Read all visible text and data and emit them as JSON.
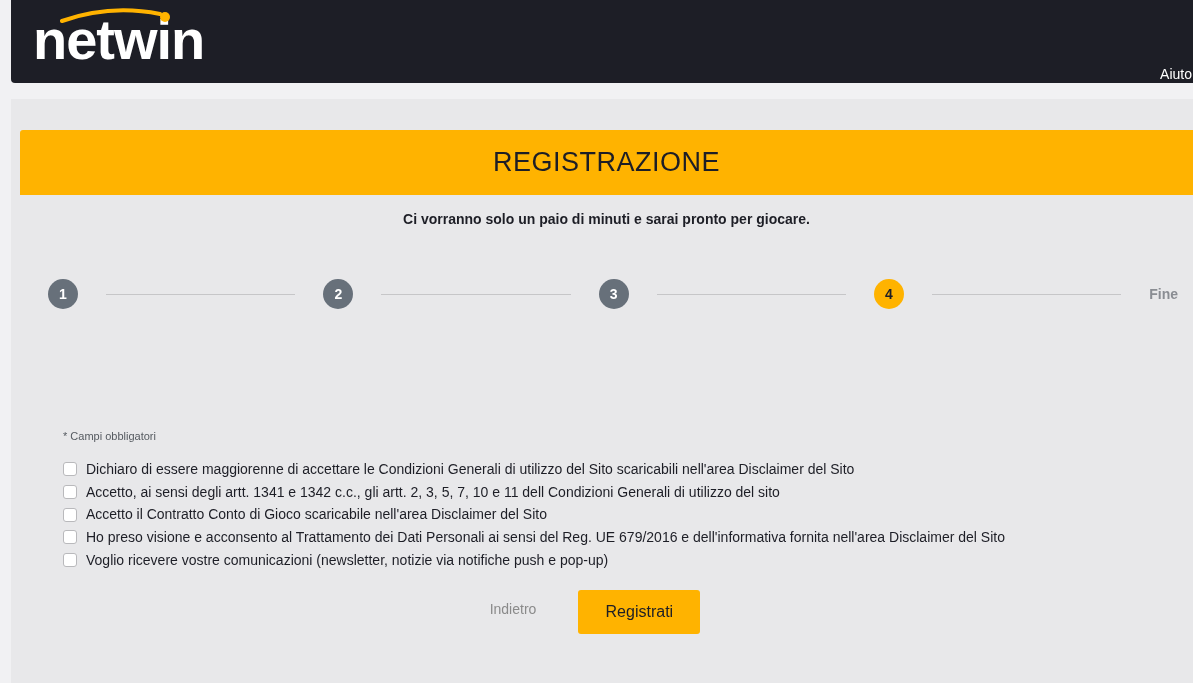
{
  "header": {
    "logo": "netwin",
    "help_link": "Aiuto"
  },
  "registration": {
    "title": "REGISTRAZIONE",
    "subtitle": "Ci vorranno solo un paio di minuti e sarai pronto per giocare.",
    "steps": [
      {
        "kind": "number",
        "label": "1",
        "selected": false
      },
      {
        "kind": "number",
        "label": "2",
        "selected": false
      },
      {
        "kind": "number",
        "label": "3",
        "selected": false
      },
      {
        "kind": "number",
        "label": "4",
        "selected": true
      },
      {
        "kind": "end",
        "label": "Fine",
        "selected": false
      }
    ],
    "required_note": "* Campi obbligatori",
    "consents": [
      {
        "label": "Dichiaro di essere maggiorenne di accettare le Condizioni Generali di utilizzo del Sito scaricabili nell'area Disclaimer del Sito",
        "checked": false
      },
      {
        "label": "Accetto, ai sensi degli artt. 1341 e 1342 c.c., gli artt. 2, 3, 5, 7, 10 e 11 dell Condizioni Generali di utilizzo del sito",
        "checked": false
      },
      {
        "label": "Accetto il Contratto Conto di Gioco scaricabile nell'area Disclaimer del Sito",
        "checked": false
      },
      {
        "label": "Ho preso visione e acconsento al Trattamento dei Dati Personali ai sensi del Reg. UE 679/2016 e dell'informativa fornita nell'area Disclaimer del Sito",
        "checked": false
      },
      {
        "label": "Voglio ricevere vostre comunicazioni (newsletter, notizie via notifiche push e pop-up)",
        "checked": false
      }
    ],
    "buttons": {
      "back": "Indietro",
      "submit": "Registrati"
    }
  }
}
